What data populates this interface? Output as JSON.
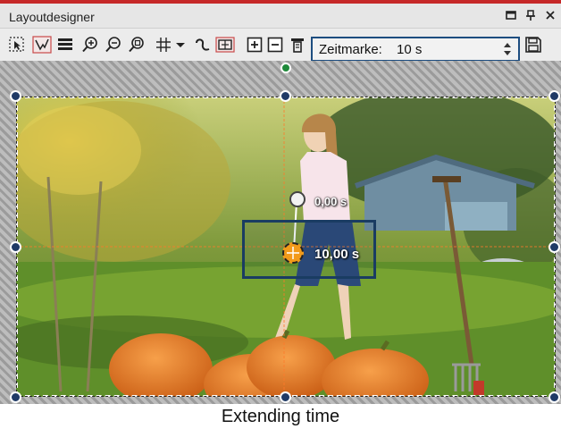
{
  "window": {
    "title": "Layoutdesigner",
    "controls": [
      "window-restore-icon",
      "pin-icon",
      "close-icon"
    ]
  },
  "toolbar": {
    "icons": [
      "select-tool-icon",
      "curve-tool-icon",
      "layers-icon",
      "zoom-in-icon",
      "zoom-out-icon",
      "zoom-fit-icon",
      "grid-icon",
      "dropdown-arrow-icon",
      "path-icon",
      "keyframe-icon",
      "add-keyframe-icon",
      "remove-keyframe-icon",
      "properties-icon",
      "save-icon"
    ],
    "time_field": {
      "label": "Zeitmarke:",
      "value": "10 s"
    }
  },
  "canvas": {
    "keyframes": [
      {
        "label": "0,00 s"
      },
      {
        "label": "10,00 s"
      }
    ],
    "colors": {
      "handle": "#1f3a66",
      "rotate_handle": "#1f8a3a",
      "keyframe_box": "#1a3c62",
      "keyframe_marker": "#f29a1a"
    }
  },
  "caption": "Extending time"
}
